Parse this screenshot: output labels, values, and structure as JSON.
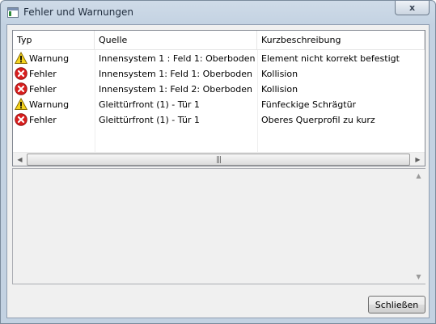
{
  "window": {
    "title": "Fehler und Warnungen",
    "close_glyph": "x"
  },
  "table": {
    "headers": [
      "Typ",
      "Quelle",
      "Kurzbeschreibung"
    ],
    "rows": [
      {
        "type_icon": "warning-icon",
        "type": "Warnung",
        "source": "Innensystem 1 : Feld 1: Oberboden",
        "description": "Element nicht korrekt befestigt"
      },
      {
        "type_icon": "error-icon",
        "type": "Fehler",
        "source": "Innensystem 1: Feld 1: Oberboden",
        "description": "Kollision"
      },
      {
        "type_icon": "error-icon",
        "type": "Fehler",
        "source": "Innensystem 1: Feld 2: Oberboden",
        "description": "Kollision"
      },
      {
        "type_icon": "warning-icon",
        "type": "Warnung",
        "source": "Gleittürfront (1) - Tür 1",
        "description": "Fünfeckige Schrägtür"
      },
      {
        "type_icon": "error-icon",
        "type": "Fehler",
        "source": "Gleittürfront (1) - Tür 1",
        "description": "Oberes Querprofil zu kurz"
      }
    ]
  },
  "details": {
    "text": ""
  },
  "buttons": {
    "close_label": "Schließen"
  },
  "colors": {
    "title_bar": "#c3d2e2",
    "error": "#d81e1e",
    "warning": "#f5d31e",
    "client_bg": "#f0f0f0"
  }
}
